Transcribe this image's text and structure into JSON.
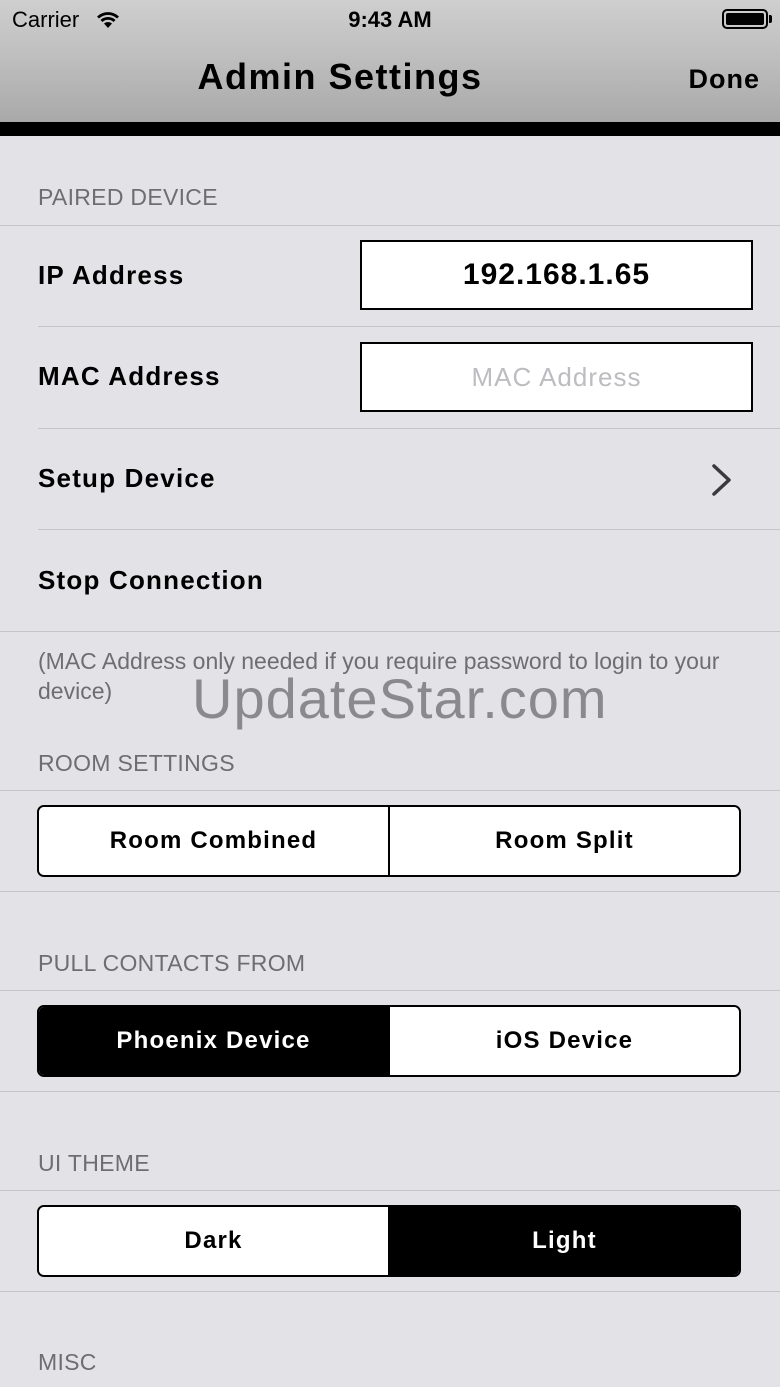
{
  "status_bar": {
    "carrier": "Carrier",
    "time": "9:43 AM"
  },
  "nav": {
    "title": "Admin Settings",
    "done_label": "Done"
  },
  "paired_device": {
    "header": "PAIRED DEVICE",
    "ip_label": "IP Address",
    "ip_value": "192.168.1.65",
    "mac_label": "MAC Address",
    "mac_placeholder": "MAC Address",
    "setup_label": "Setup Device",
    "stop_label": "Stop Connection",
    "footer": "(MAC Address only needed if you require password to login to your device)"
  },
  "watermark": "UpdateStar.com",
  "room_settings": {
    "header": "ROOM SETTINGS",
    "options": [
      "Room Combined",
      "Room Split"
    ],
    "selected": null
  },
  "pull_contacts": {
    "header": "PULL CONTACTS FROM",
    "options": [
      "Phoenix Device",
      "iOS Device"
    ],
    "selected": "Phoenix Device"
  },
  "ui_theme": {
    "header": "UI THEME",
    "options": [
      "Dark",
      "Light"
    ],
    "selected": "Light"
  },
  "misc": {
    "header": "MISC"
  },
  "colors": {
    "background": "#e3e2e7",
    "section_header": "#6d6d72",
    "selected_segment": "#000000",
    "textbox_bg": "#ffffff"
  }
}
